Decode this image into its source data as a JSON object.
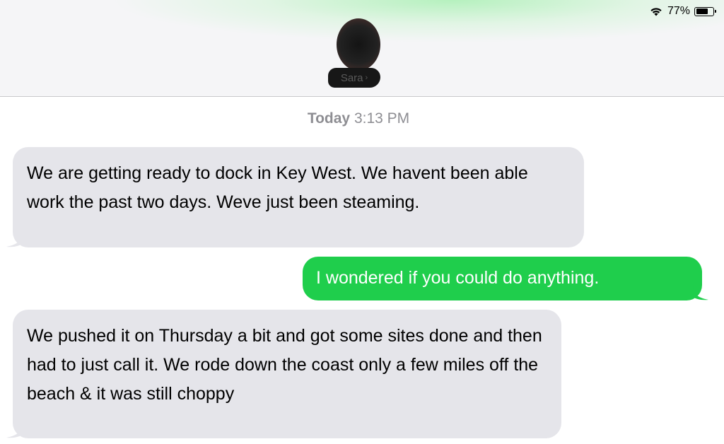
{
  "status_bar": {
    "battery_percent": "77%",
    "icons": [
      "wifi-icon",
      "battery-icon"
    ]
  },
  "contact": {
    "name": "Sara"
  },
  "thread": {
    "date_label": "Today",
    "time_label": "3:13 PM"
  },
  "messages": [
    {
      "direction": "incoming",
      "text": "We are getting ready to dock in Key West. We havent been able work the past two days. Weve just been steaming."
    },
    {
      "direction": "outgoing",
      "text": "I wondered if you could do anything."
    },
    {
      "direction": "incoming",
      "text": "We pushed it on Thursday a bit and got some sites done and then had to just call it. We rode down the coast only a few miles off the beach & it was still choppy"
    }
  ],
  "colors": {
    "incoming_bubble": "#e5e5ea",
    "outgoing_bubble": "#1fce4c",
    "timestamp_text": "#8e8e93"
  }
}
